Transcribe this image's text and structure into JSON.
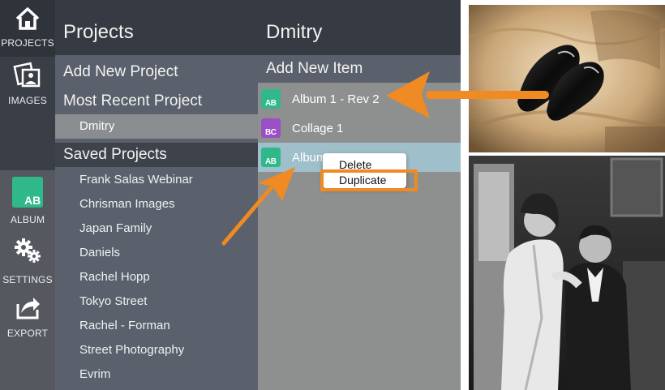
{
  "rail": {
    "projects_label": "PROJECTS",
    "images_label": "IMAGES",
    "album_label": "ALBUM",
    "album_icon_text": "AB",
    "settings_label": "SETTINGS",
    "export_label": "EXPORT"
  },
  "projects_panel": {
    "title": "Projects",
    "add_new": "Add New Project",
    "most_recent_heading": "Most Recent Project",
    "most_recent_item": "Dmitry",
    "saved_heading": "Saved Projects",
    "saved_items": [
      "Frank Salas Webinar",
      "Chrisman Images",
      "Japan Family",
      "Daniels",
      "Rachel Hopp",
      "Tokyo Street",
      "Rachel - Forman",
      "Street Photography",
      "Evrim"
    ]
  },
  "items_panel": {
    "title": "Dmitry",
    "add_new": "Add New Item",
    "items": [
      {
        "label": "Album 1 - Rev 2",
        "icon_text": "AB",
        "icon": "album-icon",
        "color": "#2fb88a"
      },
      {
        "label": "Collage 1",
        "icon_text": "BC",
        "icon": "collage-icon",
        "color": "#9a4fc4"
      },
      {
        "label": "Album 1",
        "icon_text": "AB",
        "icon": "album-icon",
        "color": "#2fb88a",
        "selected": true
      }
    ]
  },
  "context_menu": {
    "delete": "Delete",
    "duplicate": "Duplicate"
  },
  "colors": {
    "accent_orange": "#f08a22",
    "album_green": "#2fb88a",
    "collage_purple": "#9a4fc4",
    "selection_blue": "#9fbfca"
  }
}
